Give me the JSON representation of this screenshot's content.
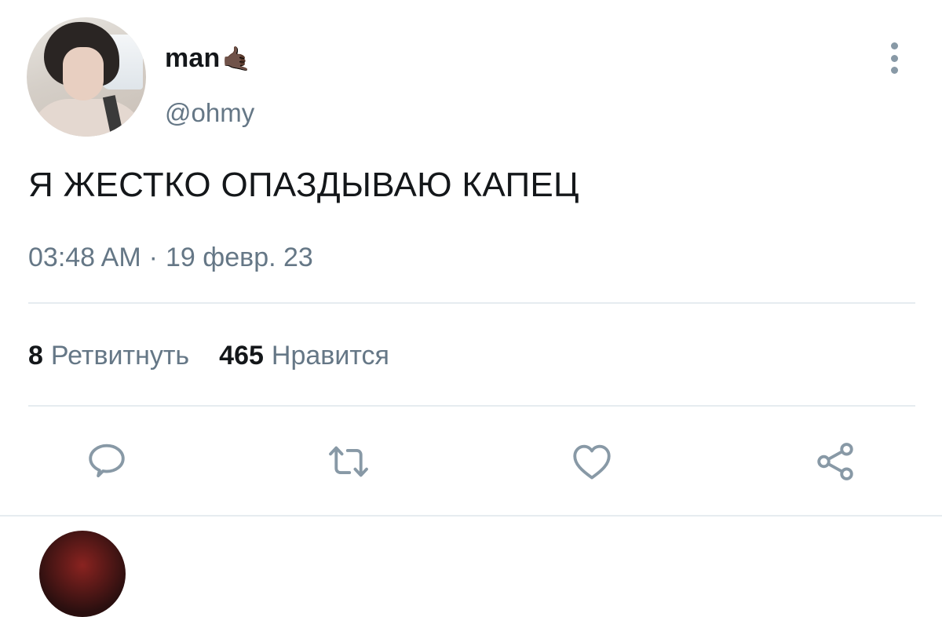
{
  "author": {
    "name": "man",
    "name_emoji": "🤙🏿",
    "handle": "@ohmy"
  },
  "tweet": {
    "text": "Я ЖЕСТКО ОПАЗДЫВАЮ КАПЕЦ",
    "time": "03:48 AM",
    "separator": "·",
    "date": "19 февр. 23"
  },
  "stats": {
    "retweets_count": "8",
    "retweets_label": "Ретвитнуть",
    "likes_count": "465",
    "likes_label": "Нравится"
  },
  "icons": {
    "more": "more-vertical-icon",
    "reply": "reply-icon",
    "retweet": "retweet-icon",
    "like": "heart-icon",
    "share": "share-icon"
  },
  "colors": {
    "text_primary": "#14171a",
    "text_secondary": "#657786",
    "icon": "#8899a6",
    "divider": "#e6ecf0"
  }
}
